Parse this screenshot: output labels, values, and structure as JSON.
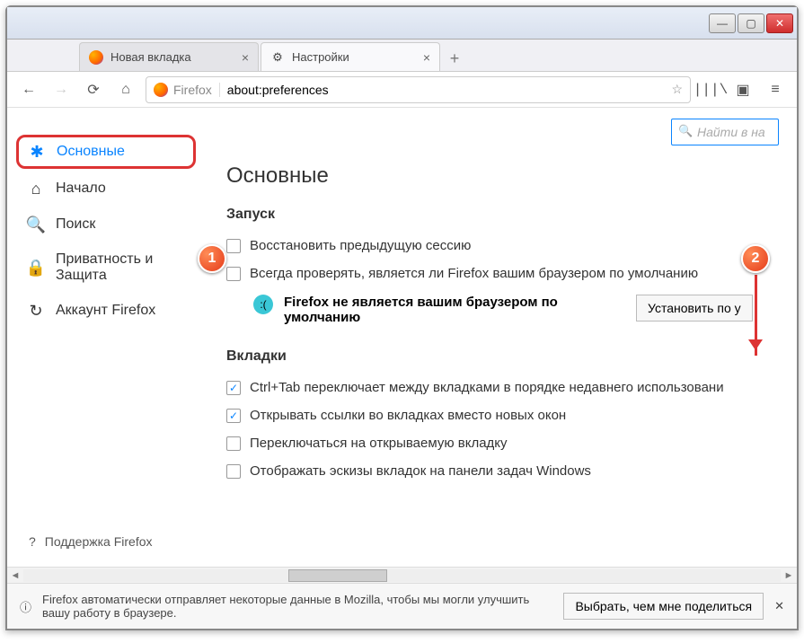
{
  "window": {
    "min": "—",
    "max": "▢",
    "close": "✕"
  },
  "tabs": {
    "tab1": {
      "label": "Новая вкладка"
    },
    "tab2": {
      "label": "Настройки",
      "icon": "⚙"
    }
  },
  "nav": {
    "brand": "Firefox",
    "url": "about:preferences"
  },
  "search": {
    "placeholder": "Найти в на"
  },
  "sidebar": {
    "general": "Основные",
    "home": "Начало",
    "search": "Поиск",
    "privacy": "Приватность и Защита",
    "account": "Аккаунт Firefox",
    "support": "Поддержка Firefox"
  },
  "main": {
    "title": "Основные",
    "startup": {
      "heading": "Запуск",
      "restore": "Восстановить предыдущую сессию",
      "always_check": "Всегда проверять, является ли Firefox вашим браузером по умолчанию",
      "not_default": "Firefox не является вашим браузером по умолчанию",
      "set_default_btn": "Установить по у"
    },
    "tabs_section": {
      "heading": "Вкладки",
      "ctrltab": "Ctrl+Tab переключает между вкладками в порядке недавнего использовани",
      "open_links": "Открывать ссылки во вкладках вместо новых окон",
      "switch": "Переключаться на открываемую вкладку",
      "thumbs": "Отображать эскизы вкладок на панели задач Windows"
    }
  },
  "notif": {
    "msg": "Firefox автоматически отправляет некоторые данные в Mozilla, чтобы мы могли улучшить вашу работу в браузере.",
    "btn": "Выбрать, чем мне поделиться"
  },
  "badges": {
    "b1": "1",
    "b2": "2"
  }
}
